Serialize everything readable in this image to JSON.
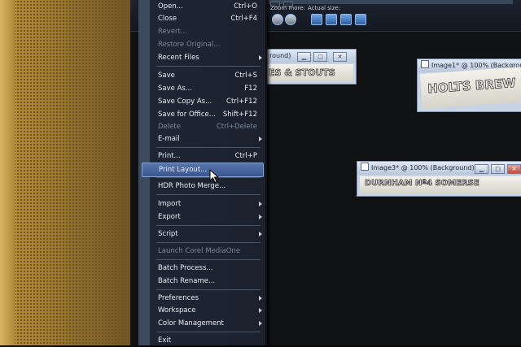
{
  "toolbar": {
    "zoom_label": "Zoom more:",
    "actual_size_label": "Actual size:"
  },
  "windows": [
    {
      "title": "round)",
      "text": "ES &   STOUTS"
    },
    {
      "title": "Image1* @ 100% (Backgrou",
      "text": "HOLTS BREW"
    },
    {
      "title": "Image3* @ 100% (Background)",
      "text": "DURNHAM      Nº4      SOMERSE"
    }
  ],
  "menu": {
    "items": [
      {
        "label": "Open...",
        "shortcut": "Ctrl+O"
      },
      {
        "label": "Close",
        "shortcut": "Ctrl+F4"
      },
      {
        "label": "Revert...",
        "shortcut": "",
        "disabled": true
      },
      {
        "label": "Restore Original...",
        "shortcut": "",
        "disabled": true
      },
      {
        "label": "Recent Files",
        "shortcut": "",
        "submenu": true
      },
      {
        "label": "Save",
        "shortcut": "Ctrl+S"
      },
      {
        "label": "Save As...",
        "shortcut": "F12"
      },
      {
        "label": "Save Copy As...",
        "shortcut": "Ctrl+F12"
      },
      {
        "label": "Save for Office...",
        "shortcut": "Shift+F12"
      },
      {
        "label": "Delete",
        "shortcut": "Ctrl+Delete",
        "disabled": true
      },
      {
        "label": "E-mail",
        "shortcut": "",
        "submenu": true
      },
      {
        "label": "Print...",
        "shortcut": "Ctrl+P"
      },
      {
        "label": "Print Layout...",
        "shortcut": "",
        "highlighted": true
      },
      {
        "label": "HDR Photo Merge...",
        "shortcut": ""
      },
      {
        "label": "Import",
        "shortcut": "",
        "submenu": true
      },
      {
        "label": "Export",
        "shortcut": "",
        "submenu": true
      },
      {
        "label": "Script",
        "shortcut": "",
        "submenu": true
      },
      {
        "label": "Launch Corel MediaOne",
        "shortcut": "",
        "disabled": true
      },
      {
        "label": "Batch Process...",
        "shortcut": ""
      },
      {
        "label": "Batch Rename...",
        "shortcut": ""
      },
      {
        "label": "Preferences",
        "shortcut": "",
        "submenu": true
      },
      {
        "label": "Workspace",
        "shortcut": "",
        "submenu": true
      },
      {
        "label": "Color Management",
        "shortcut": "",
        "submenu": true
      },
      {
        "label": "Exit",
        "shortcut": ""
      }
    ]
  }
}
